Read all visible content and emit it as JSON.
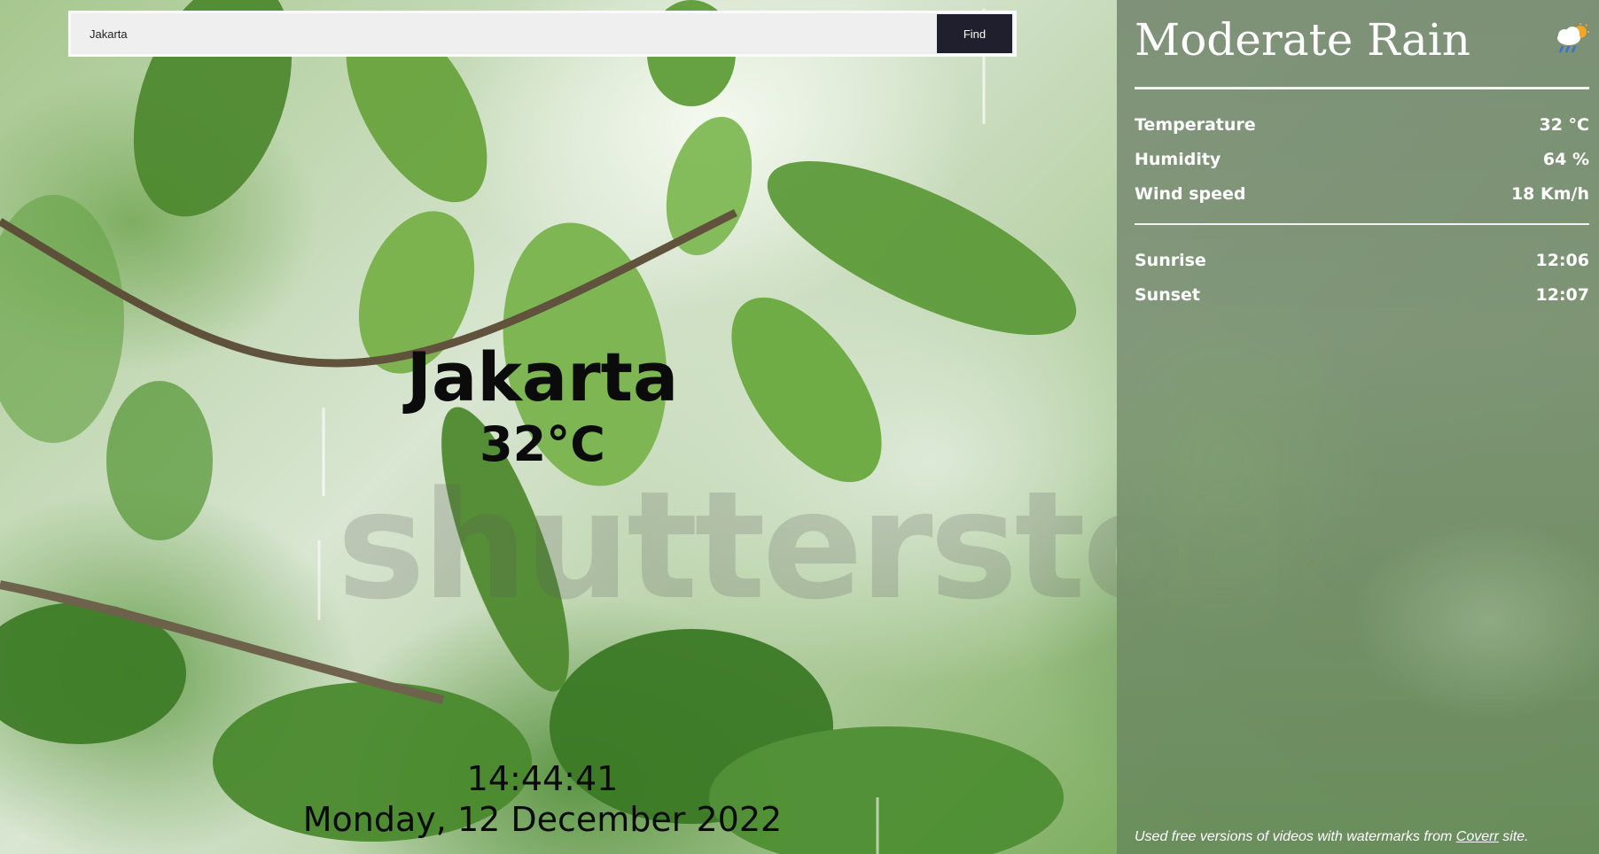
{
  "search": {
    "value": "Jakarta",
    "button_label": "Find"
  },
  "location": {
    "city": "Jakarta",
    "temperature": "32°C"
  },
  "clock": {
    "time": "14:44:41",
    "date": "Monday, 12 December 2022"
  },
  "watermark": "shutterstock",
  "panel": {
    "condition": "Moderate Rain",
    "condition_icon": "rain-cloud-sun-icon",
    "stats": [
      {
        "label": "Temperature",
        "value": "32 °C"
      },
      {
        "label": "Humidity",
        "value": "64 %"
      },
      {
        "label": "Wind speed",
        "value": "18 Km/h"
      }
    ],
    "sun": [
      {
        "label": "Sunrise",
        "value": "12:06"
      },
      {
        "label": "Sunset",
        "value": "12:07"
      }
    ],
    "footer": {
      "prefix": "Used free versions of videos with watermarks from ",
      "link_text": "Coverr",
      "suffix": " site."
    }
  },
  "colors": {
    "find_button_bg": "#1f1f2e",
    "search_bg": "#efefef",
    "panel_text": "#ffffff",
    "city_text": "#0b0b0b"
  }
}
